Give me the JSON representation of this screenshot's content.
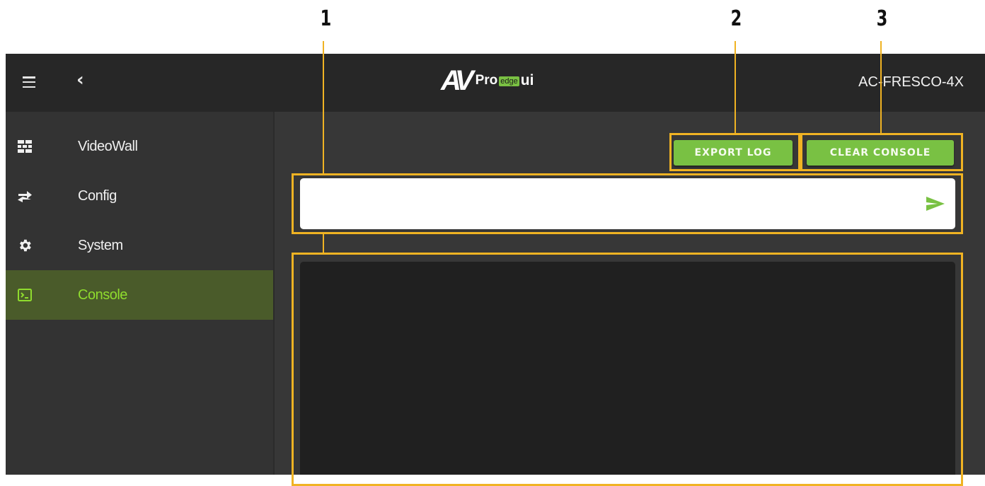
{
  "callouts": [
    "1",
    "2",
    "3"
  ],
  "topbar": {
    "logo": {
      "av": "AV",
      "pro": "Pro",
      "edge": "edge",
      "ui": "ui"
    },
    "device_name": "AC-FRESCO-4X",
    "menu_icon": "hamburger-icon",
    "back_icon": "chevron-left-icon"
  },
  "sidebar": {
    "items": [
      {
        "label": "VideoWall",
        "icon": "videowall-icon",
        "active": false
      },
      {
        "label": "Config",
        "icon": "swap-arrows-icon",
        "active": false
      },
      {
        "label": "System",
        "icon": "gear-icon",
        "active": false
      },
      {
        "label": "Console",
        "icon": "terminal-icon",
        "active": true
      }
    ]
  },
  "main": {
    "export_label": "EXPORT LOG",
    "clear_label": "CLEAR CONSOLE",
    "command_input": {
      "value": "",
      "placeholder": ""
    },
    "send_icon": "send-icon"
  },
  "colors": {
    "accent": "#79c143",
    "active_text": "#8fdc2e",
    "active_bg": "#4a5b2a",
    "callout": "#f0b323"
  }
}
